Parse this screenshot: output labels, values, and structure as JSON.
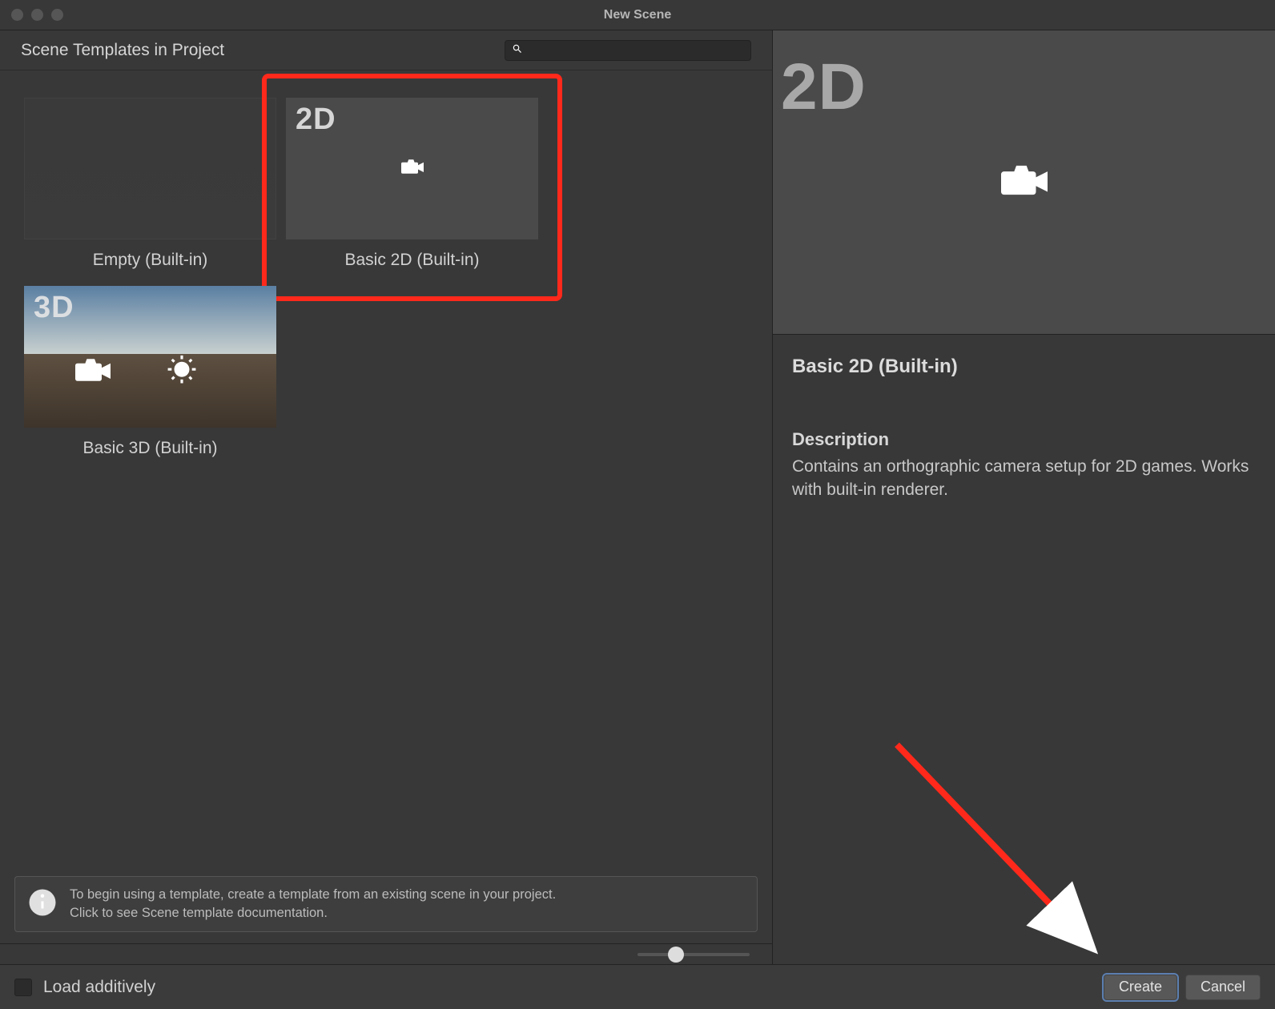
{
  "window": {
    "title": "New Scene"
  },
  "left": {
    "header_title": "Scene Templates in Project",
    "search_placeholder": ""
  },
  "templates": [
    {
      "id": "empty",
      "thumb_label": "",
      "caption": "Empty (Built-in)"
    },
    {
      "id": "basic2d",
      "thumb_label": "2D",
      "caption": "Basic 2D (Built-in)"
    },
    {
      "id": "basic3d",
      "thumb_label": "3D",
      "caption": "Basic 3D (Built-in)"
    }
  ],
  "hint": {
    "line1": "To begin using a template, create a template from an existing scene in your project.",
    "line2": "Click to see Scene template documentation."
  },
  "detail": {
    "thumb_label": "2D",
    "title": "Basic 2D (Built-in)",
    "section_label": "Description",
    "description": "Contains an orthographic camera setup for 2D games. Works with built-in renderer."
  },
  "footer": {
    "load_additively_label": "Load additively",
    "create": "Create",
    "cancel": "Cancel"
  },
  "annotation": {
    "highlight_target": "basic2d",
    "arrow_points_to": "create-button"
  }
}
